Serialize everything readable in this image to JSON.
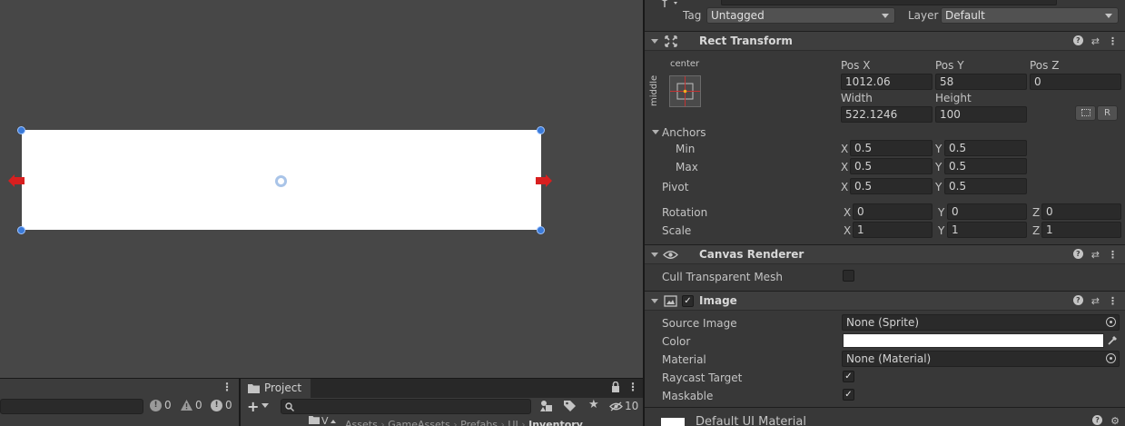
{
  "console": {
    "counts": {
      "info": "0",
      "warning": "0",
      "error": "0"
    }
  },
  "project": {
    "tab_label": "Project",
    "hidden_count": "10",
    "breadcrumb": [
      "Assets",
      "GameAssets",
      "Prefabs",
      "UI",
      "Inventory"
    ],
    "folder_label": "V"
  },
  "inspector": {
    "tag_label": "Tag",
    "tag_value": "Untagged",
    "layer_label": "Layer",
    "layer_value": "Default",
    "rect_transform": {
      "title": "Rect Transform",
      "anchor_preset_top": "center",
      "anchor_preset_side": "middle",
      "pos_x_label": "Pos X",
      "pos_x": "1012.06",
      "pos_y_label": "Pos Y",
      "pos_y": "58",
      "pos_z_label": "Pos Z",
      "pos_z": "0",
      "width_label": "Width",
      "width": "522.1246",
      "height_label": "Height",
      "height": "100",
      "raw_button": "R",
      "anchors_label": "Anchors",
      "min_label": "Min",
      "min_x": "0.5",
      "min_y": "0.5",
      "max_label": "Max",
      "max_x": "0.5",
      "max_y": "0.5",
      "pivot_label": "Pivot",
      "pivot_x": "0.5",
      "pivot_y": "0.5",
      "rotation_label": "Rotation",
      "rot_x": "0",
      "rot_y": "0",
      "rot_z": "0",
      "scale_label": "Scale",
      "scale_x": "1",
      "scale_y": "1",
      "scale_z": "1",
      "x": "X",
      "y": "Y",
      "z": "Z"
    },
    "canvas_renderer": {
      "title": "Canvas Renderer",
      "cull_label": "Cull Transparent Mesh",
      "cull_checked": false
    },
    "image": {
      "title": "Image",
      "enabled": true,
      "source_image_label": "Source Image",
      "source_image": "None (Sprite)",
      "color_label": "Color",
      "color_value": "#ffffff",
      "material_label": "Material",
      "material": "None (Material)",
      "raycast_label": "Raycast Target",
      "raycast_checked": true,
      "maskable_label": "Maskable",
      "maskable_checked": true
    },
    "default_material": {
      "title": "Default UI Material"
    }
  }
}
